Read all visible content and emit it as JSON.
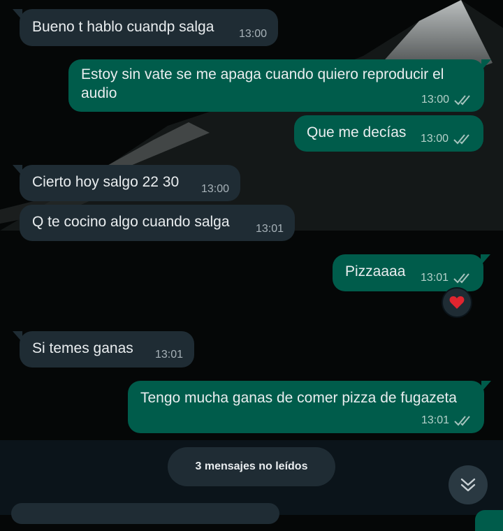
{
  "messages": [
    {
      "direction": "in",
      "text": "Bueno t hablo cuandp salga",
      "time": "13:00"
    },
    {
      "direction": "out",
      "text_line1": "Estoy sin vate se me apaga cuando quiero reproducir el",
      "text_line2": "audio",
      "time": "13:00",
      "status": "read"
    },
    {
      "direction": "out",
      "text": "Que me decías",
      "time": "13:00",
      "status": "read"
    },
    {
      "direction": "in",
      "text": "Cierto hoy salgo 22 30",
      "time": "13:00"
    },
    {
      "direction": "in",
      "text": "Q te cocino algo cuando salga",
      "time": "13:01"
    },
    {
      "direction": "out",
      "text": "Pizzaaaa",
      "time": "13:01",
      "status": "read",
      "reaction": "❤️"
    },
    {
      "direction": "in",
      "text": "Si temes ganas",
      "time": "13:01"
    },
    {
      "direction": "out",
      "text": "Tengo mucha ganas de comer pizza de fugazeta",
      "time": "13:01",
      "status": "read"
    }
  ],
  "unread_banner": "3 mensajes no leídos",
  "icons": {
    "read_receipt": "double-check-icon",
    "scroll_down": "double-chevron-down-icon",
    "reaction": "heart-icon"
  },
  "colors": {
    "incoming_bubble": "#1f2c34",
    "outgoing_bubble": "#005c4b",
    "read_check": "#a7c4be"
  }
}
